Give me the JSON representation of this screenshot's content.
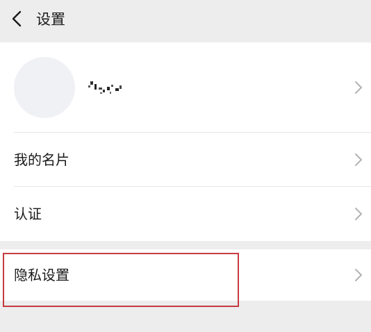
{
  "header": {
    "title": "设置",
    "back_icon": "chevron-left-icon"
  },
  "profile": {
    "nickname": "",
    "avatar": "avatar-placeholder",
    "chevron_icon": "chevron-right-icon"
  },
  "menu": {
    "items": [
      {
        "label": "我的名片",
        "icon": "chevron-right-icon"
      },
      {
        "label": "认证",
        "icon": "chevron-right-icon"
      },
      {
        "label": "隐私设置",
        "icon": "chevron-right-icon"
      }
    ]
  },
  "colors": {
    "background": "#ededed",
    "card": "#ffffff",
    "text": "#1a1a1a",
    "chevron": "#b2b2b2",
    "divider": "#e5e5e5",
    "highlight": "#c63a3f"
  }
}
